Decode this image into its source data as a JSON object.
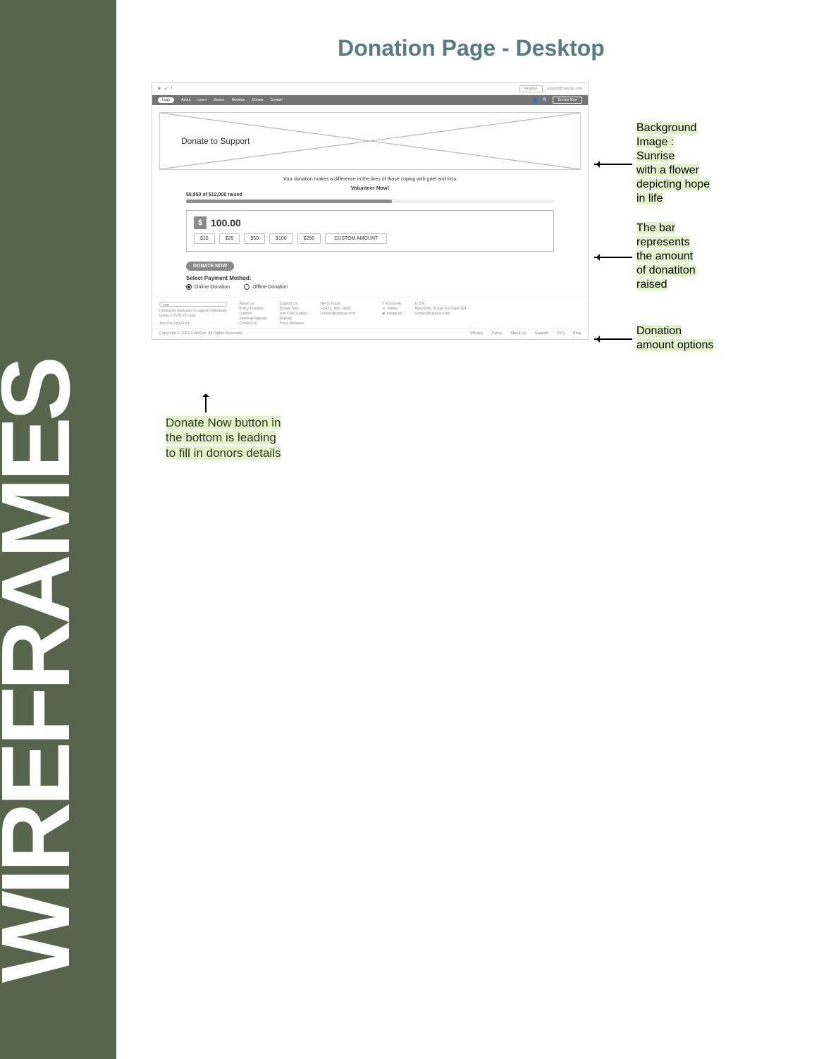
{
  "sidebar_label": "WIREFRAMES",
  "page_title": "Donation Page - Desktop",
  "util": {
    "register": "Register",
    "email": "support@carecan.com"
  },
  "nav": {
    "logo": "Logo",
    "items": [
      "About",
      "Learn",
      "Stories",
      "Reviews",
      "Donate",
      "Contact"
    ],
    "donate_btn": "Donate Now"
  },
  "hero_title": "Donate to Support",
  "sub_text": "Your donation makes a difference in the lives of those coping with grief and loss.",
  "volunteer": "Volunteer Now!",
  "raised_label": "$6,850 of $12,000 raised",
  "amount_value": "100.00",
  "presets": [
    "$10",
    "$25",
    "$50",
    "$100",
    "$250"
  ],
  "custom_label": "CUSTOM AMOUNT",
  "donate_now_pill": "DONATE NOW",
  "spm_label": "Select Payment Method:",
  "payment_options": [
    "Online Donation",
    "Offline Donation"
  ],
  "footer": {
    "tagline1": "community dedicated to support individuals",
    "tagline2": "during COVID-19 crisis.",
    "tagline3": "Join Our Email List",
    "col_about": [
      "About Us",
      "Policy Priorities",
      "Careers",
      "Financial Reports",
      "Contact Us"
    ],
    "col_support": [
      "Support Us",
      "Donate Now",
      "Live Chat Support",
      "Reports",
      "Press Releases"
    ],
    "contact_title": "Get in Touch",
    "phone": "+(941) - 866 - 4695",
    "contact_email": "contact@carecan.com",
    "social": [
      "Facebook",
      "Twitter",
      "Instagram"
    ],
    "addr1": "U.S.A.",
    "addr2": "Manhattan 90 Ave 2nd Suite 304",
    "addr3": "contact@carecan.com",
    "copyright": "Copyright © 2022 CareCan. All Rights Reserved.",
    "btm_links": [
      "Privacy",
      "Policy",
      "About Us",
      "Support",
      "FAQ",
      "Blog"
    ]
  },
  "annotations": {
    "bg": [
      "Background",
      "Image :",
      "Sunrise",
      "with a flower",
      "depicting hope",
      "in life"
    ],
    "bar": [
      "The bar",
      "represents",
      "the amount",
      "of donatiton",
      "raised"
    ],
    "donation": [
      "Donation",
      "amount options"
    ],
    "bottom": [
      "Donate Now button in",
      "the bottom is leading",
      "to fill in donors details"
    ]
  }
}
